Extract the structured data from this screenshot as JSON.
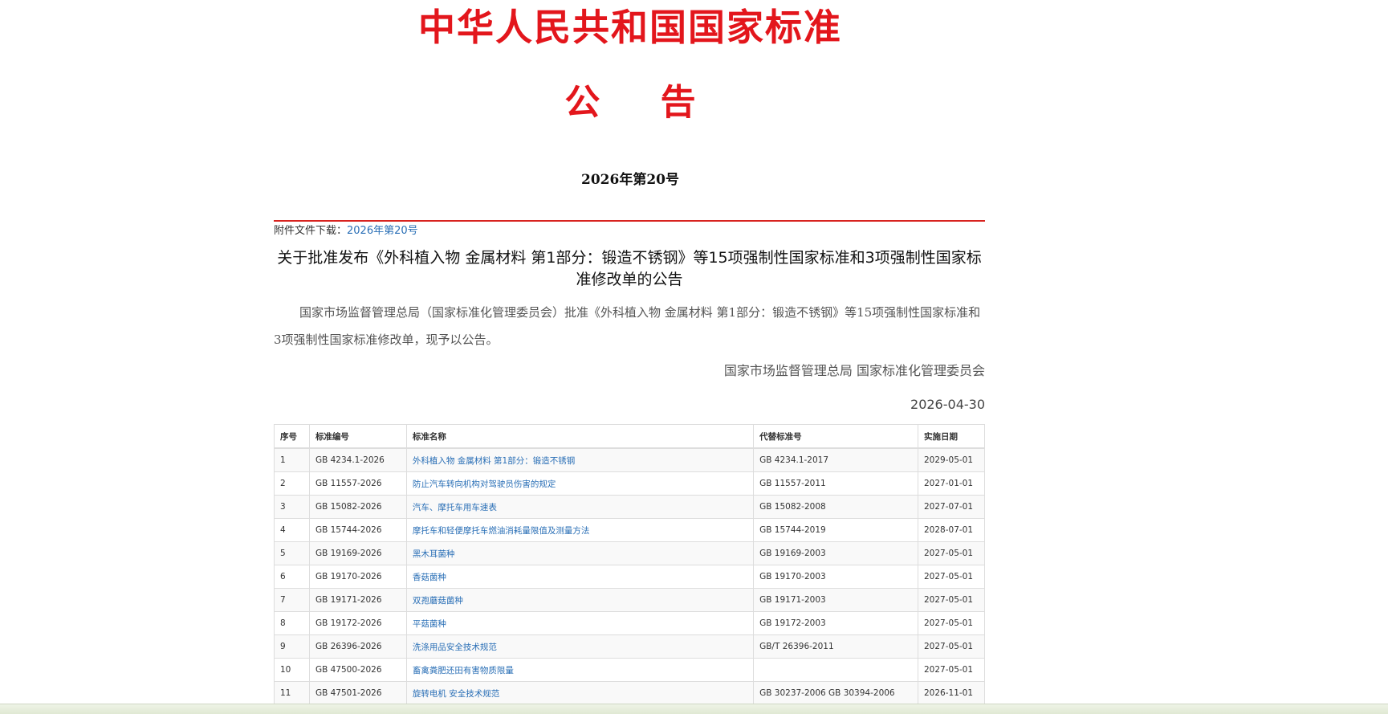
{
  "header": {
    "title": "中华人民共和国国家标准",
    "announcement": "公 告",
    "issue_number": "2026年第20号"
  },
  "attachment": {
    "label": "附件文件下载：",
    "link_text": "2026年第20号"
  },
  "document": {
    "title": "关于批准发布《外科植入物 金属材料 第1部分：锻造不锈钢》等15项强制性国家标准和3项强制性国家标准修改单的公告",
    "body": "国家市场监督管理总局（国家标准化管理委员会）批准《外科植入物 金属材料 第1部分：锻造不锈钢》等15项强制性国家标准和3项强制性国家标准修改单，现予以公告。",
    "signer": "国家市场监督管理总局 国家标准化管理委员会",
    "date": "2026-04-30"
  },
  "table": {
    "headers": [
      "序号",
      "标准编号",
      "标准名称",
      "代替标准号",
      "实施日期"
    ],
    "rows": [
      {
        "no": "1",
        "code": "GB 4234.1-2026",
        "name": "外科植入物 金属材料 第1部分：锻造不锈钢",
        "replaces": "GB 4234.1-2017",
        "date": "2029-05-01"
      },
      {
        "no": "2",
        "code": "GB 11557-2026",
        "name": "防止汽车转向机构对驾驶员伤害的规定",
        "replaces": "GB 11557-2011",
        "date": "2027-01-01"
      },
      {
        "no": "3",
        "code": "GB 15082-2026",
        "name": "汽车、摩托车用车速表",
        "replaces": "GB 15082-2008",
        "date": "2027-07-01"
      },
      {
        "no": "4",
        "code": "GB 15744-2026",
        "name": "摩托车和轻便摩托车燃油消耗量限值及测量方法",
        "replaces": "GB 15744-2019",
        "date": "2028-07-01"
      },
      {
        "no": "5",
        "code": "GB 19169-2026",
        "name": "黑木耳菌种",
        "replaces": "GB 19169-2003",
        "date": "2027-05-01"
      },
      {
        "no": "6",
        "code": "GB 19170-2026",
        "name": "香菇菌种",
        "replaces": "GB 19170-2003",
        "date": "2027-05-01"
      },
      {
        "no": "7",
        "code": "GB 19171-2026",
        "name": "双孢蘑菇菌种",
        "replaces": "GB 19171-2003",
        "date": "2027-05-01"
      },
      {
        "no": "8",
        "code": "GB 19172-2026",
        "name": "平菇菌种",
        "replaces": "GB 19172-2003",
        "date": "2027-05-01"
      },
      {
        "no": "9",
        "code": "GB 26396-2026",
        "name": "洗涤用品安全技术规范",
        "replaces": "GB/T 26396-2011",
        "date": "2027-05-01"
      },
      {
        "no": "10",
        "code": "GB 47500-2026",
        "name": "畜禽粪肥还田有害物质限量",
        "replaces": "",
        "date": "2027-05-01"
      },
      {
        "no": "11",
        "code": "GB 47501-2026",
        "name": "旋转电机 安全技术规范",
        "replaces": "GB 30237-2006 GB 30394-2006",
        "date": "2026-11-01"
      }
    ]
  }
}
